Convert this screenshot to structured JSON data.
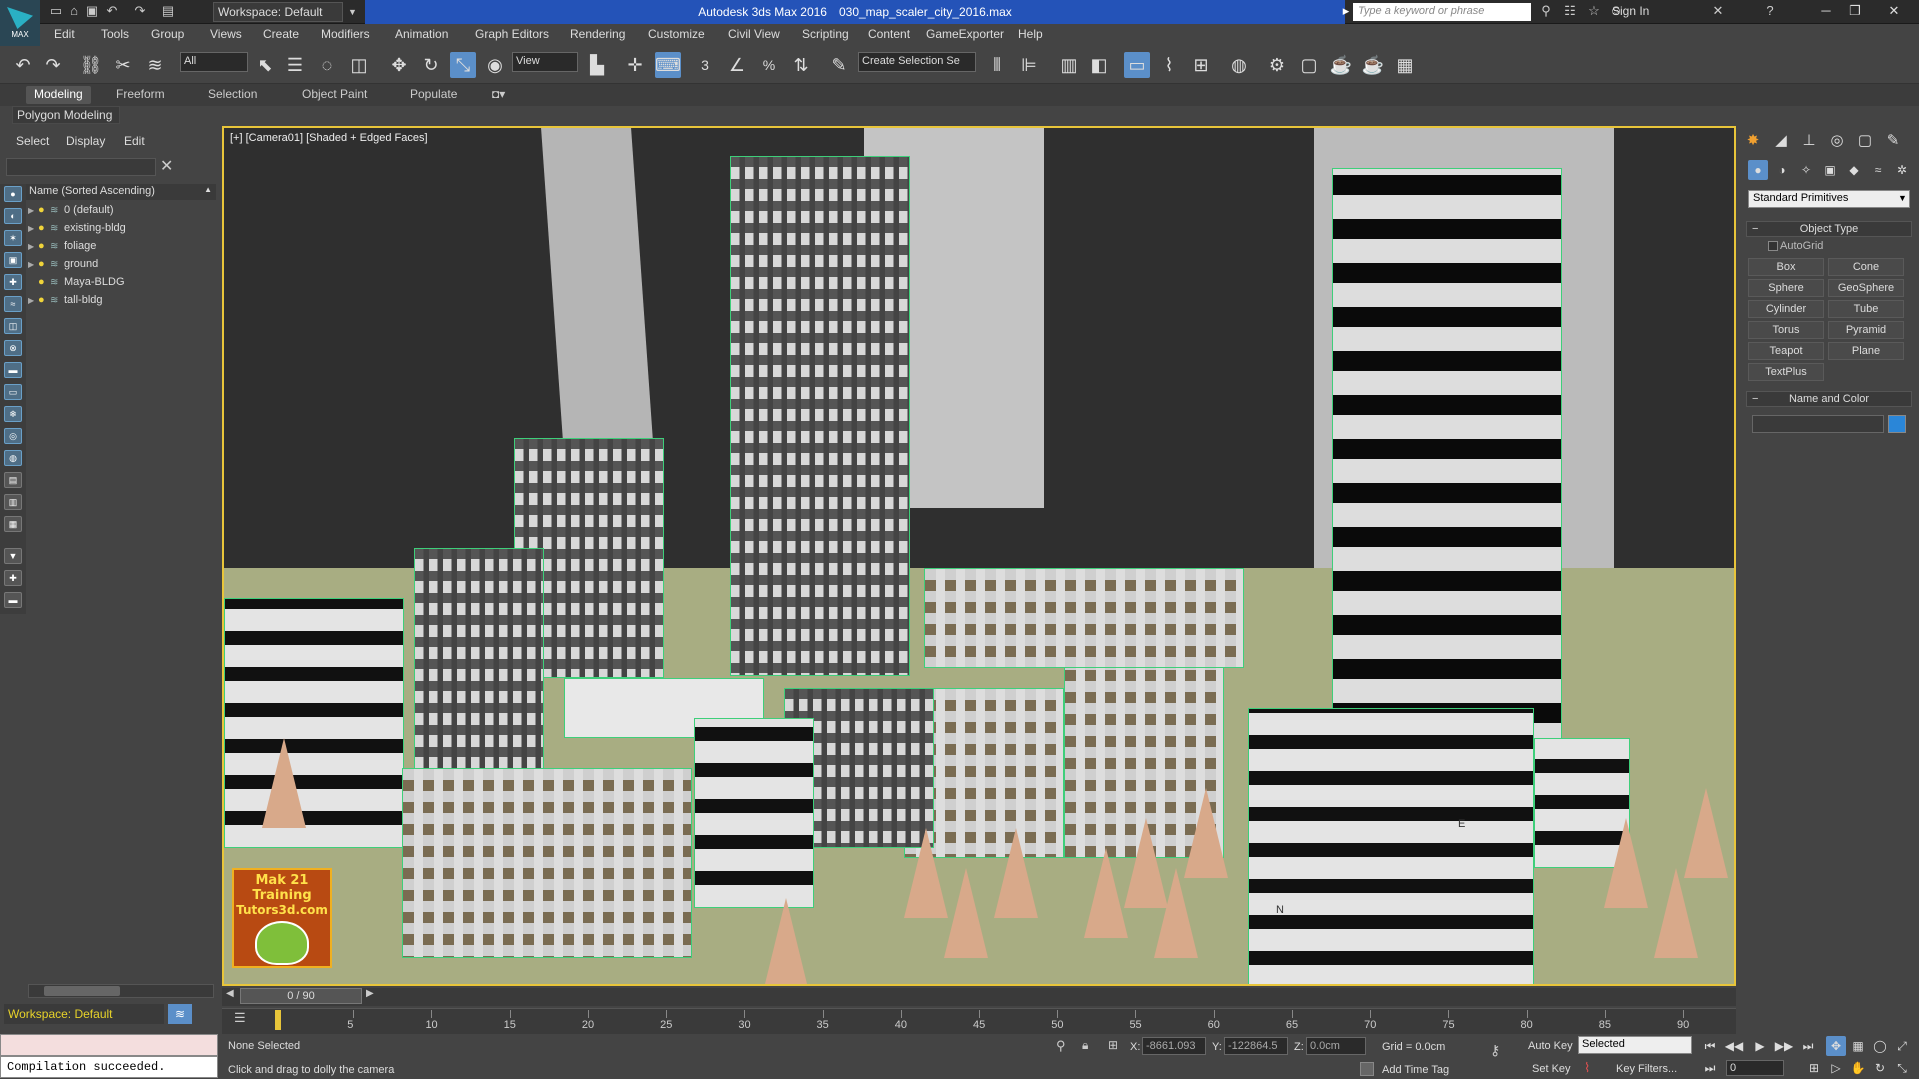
{
  "titlebar": {
    "app_name": "Autodesk 3ds Max 2016",
    "file_name": "030_map_scaler_city_2016.max",
    "workspace": "Workspace: Default",
    "search_placeholder": "Type a keyword or phrase",
    "sign_in": "Sign In",
    "app_icon": "MAX"
  },
  "menu": [
    "Edit",
    "Tools",
    "Group",
    "Views",
    "Create",
    "Modifiers",
    "Animation",
    "Graph Editors",
    "Rendering",
    "Customize",
    "Civil View",
    "Scripting",
    "Content",
    "GameExporter",
    "Help"
  ],
  "toolbar": {
    "filter": "All",
    "ref_coord": "View",
    "selection_set": "Create Selection Se",
    "snaps": [
      "3",
      "%"
    ]
  },
  "ribbon": {
    "tabs": [
      "Modeling",
      "Freeform",
      "Selection",
      "Object Paint",
      "Populate"
    ],
    "active": "Modeling",
    "sub": "Polygon Modeling"
  },
  "explorer": {
    "tabs": [
      "Select",
      "Display",
      "Edit"
    ],
    "column": "Name (Sorted Ascending)",
    "layers": [
      "0 (default)",
      "existing-bldg",
      "foliage",
      "ground",
      "Maya-BLDG",
      "tall-bldg"
    ],
    "workspace": "Workspace: Default"
  },
  "viewport": {
    "label": "[+] [Camera01] [Shaded + Edged Faces]",
    "logo_line1": "Mak 21 Training",
    "logo_line2": "Tutors3d.com",
    "axis_labels": [
      "E",
      "N"
    ]
  },
  "command_panel": {
    "dropdown": "Standard Primitives",
    "rollout_object_type": "Object Type",
    "autogrid": "AutoGrid",
    "primitives": [
      "Box",
      "Cone",
      "Sphere",
      "GeoSphere",
      "Cylinder",
      "Tube",
      "Torus",
      "Pyramid",
      "Teapot",
      "Plane",
      "TextPlus"
    ],
    "rollout_name_color": "Name and Color",
    "accent": "#2a86d8"
  },
  "timeline": {
    "slider": "0 / 90",
    "ticks": [
      "5",
      "10",
      "15",
      "20",
      "25",
      "30",
      "35",
      "40",
      "45",
      "50",
      "55",
      "60",
      "65",
      "70",
      "75",
      "80",
      "85",
      "90"
    ]
  },
  "status": {
    "selection": "None Selected",
    "prompt": "Click and drag to dolly the camera",
    "x_label": "X:",
    "x": "-8661.093",
    "y_label": "Y:",
    "y": "-122864.5",
    "z_label": "Z:",
    "z": "0.0cm",
    "grid": "Grid = 0.0cm",
    "auto_key": "Auto Key",
    "set_key": "Set Key",
    "key_mode": "Selected",
    "key_filters": "Key Filters...",
    "add_time_tag": "Add Time Tag",
    "frame": "0",
    "maxscript_out": "Compilation succeeded."
  },
  "colors": {
    "title_active": "#2453b8",
    "viewport_border": "#e8c53a",
    "selection_edges": "#3ecf7a"
  }
}
